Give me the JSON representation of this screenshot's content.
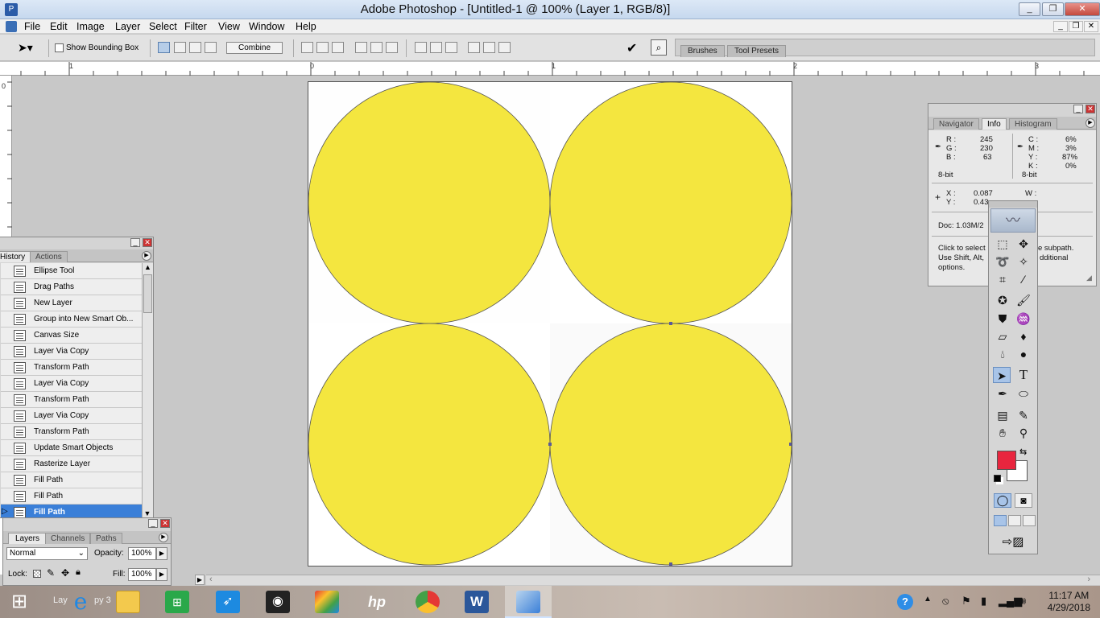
{
  "window": {
    "title": "Adobe Photoshop - [Untitled-1 @ 100% (Layer 1, RGB/8)]"
  },
  "menu": [
    "File",
    "Edit",
    "Image",
    "Layer",
    "Select",
    "Filter",
    "View",
    "Window",
    "Help"
  ],
  "options": {
    "show_bounding_box": "Show Bounding Box",
    "combine": "Combine"
  },
  "palette_well": {
    "tabs": [
      "Brushes",
      "Tool Presets"
    ]
  },
  "rulers": {
    "h": [
      "1",
      "0",
      "1",
      "2",
      "3"
    ],
    "v": [
      "0"
    ]
  },
  "history": {
    "tabs": [
      "History",
      "Actions"
    ],
    "items": [
      "Ellipse Tool",
      "Drag Paths",
      "New Layer",
      "Group into New Smart Ob...",
      "Canvas Size",
      "Layer Via Copy",
      "Transform Path",
      "Layer Via Copy",
      "Transform Path",
      "Layer Via Copy",
      "Transform Path",
      "Update Smart Objects",
      "Rasterize Layer",
      "Fill Path",
      "Fill Path",
      "Fill Path"
    ],
    "selected_index": 15
  },
  "layers": {
    "tabs": [
      "Layers",
      "Channels",
      "Paths"
    ],
    "blend_mode": "Normal",
    "opacity_label": "Opacity:",
    "opacity": "100%",
    "lock_label": "Lock:",
    "fill_label": "Fill:",
    "fill": "100%"
  },
  "info": {
    "tabs": [
      "Navigator",
      "Info",
      "Histogram"
    ],
    "rgb": {
      "R": "245",
      "G": "230",
      "B": "63"
    },
    "cmyk": {
      "C": "6%",
      "M": "3%",
      "Y": "87%",
      "K": "0%"
    },
    "bit_left": "8-bit",
    "bit_right": "8-bit",
    "x_label": "X :",
    "x": "0.087",
    "y_label": "Y :",
    "y": "0.43",
    "w_label": "W :",
    "doc": "Doc: 1.03M/2",
    "hint1": "Click to select",
    "hint1_right": "e subpath.",
    "hint2": "Use Shift, Alt,",
    "hint2_right": "dditional",
    "hint3": "options."
  },
  "colors": {
    "fill": "#F4E63F",
    "foreground": "#E8253E",
    "background": "#FFFFFF",
    "selection": "#3A7FD8"
  },
  "icons": [
    "move-icon",
    "marquee-icon",
    "lasso-icon",
    "magic-wand-icon",
    "crop-icon",
    "slice-icon",
    "healing-icon",
    "brush-icon",
    "stamp-icon",
    "history-brush-icon",
    "eraser-icon",
    "paint-bucket-icon",
    "blur-icon",
    "dodge-icon",
    "path-select-icon",
    "type-icon",
    "pen-icon",
    "ellipse-shape-icon",
    "notes-icon",
    "eyedropper-icon",
    "hand-icon",
    "zoom-icon"
  ],
  "taskbar": {
    "item_label": "Lay",
    "item_label2": "py 3",
    "time": "11:17 AM",
    "date": "4/29/2018"
  }
}
